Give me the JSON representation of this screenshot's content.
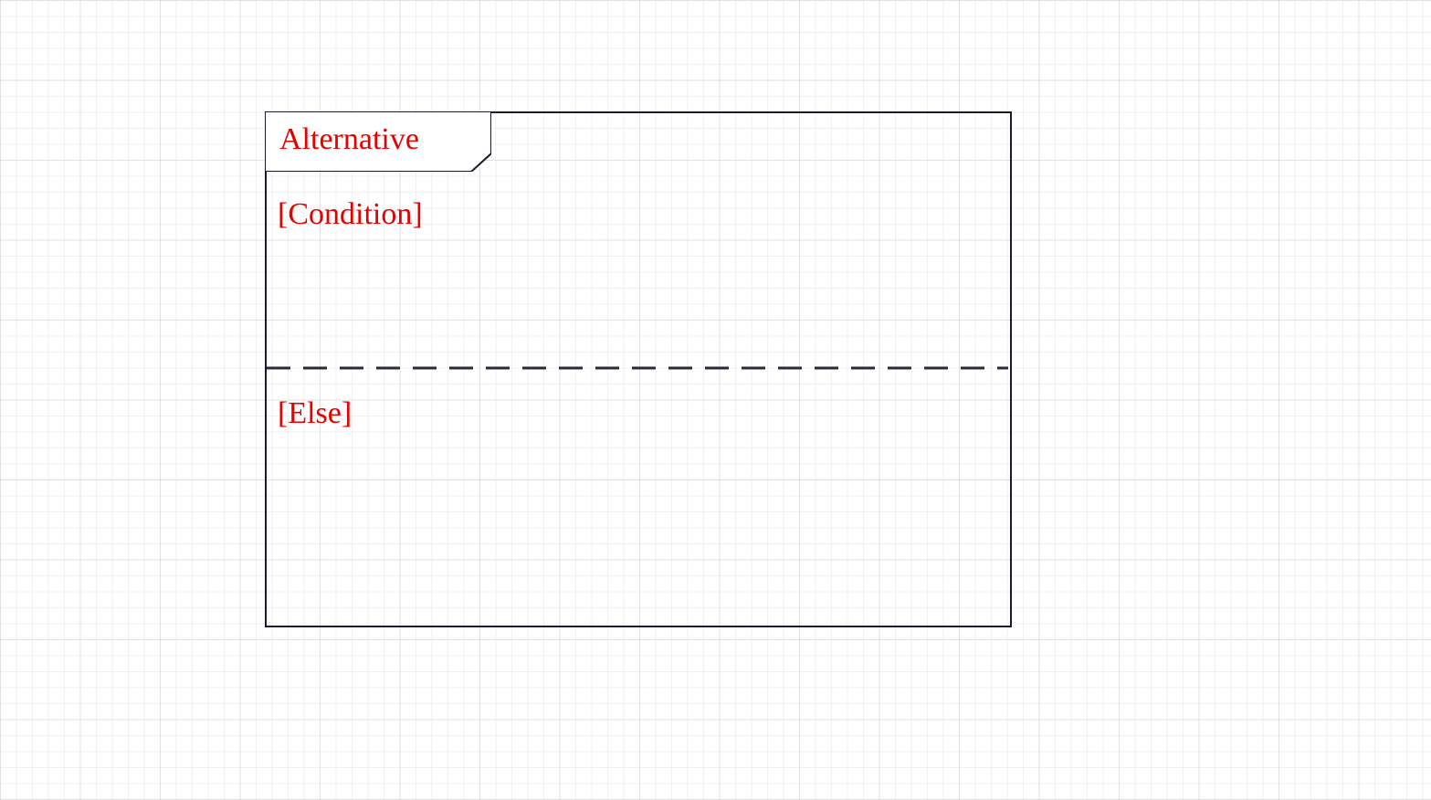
{
  "diagram": {
    "type": "uml-sequence-combined-fragment",
    "operator": "Alternative",
    "operands": [
      {
        "guard": "[Condition]"
      },
      {
        "guard": "[Else]"
      }
    ],
    "colors": {
      "text": "#e60000",
      "border": "#1a1a2e",
      "separator": "#2a2a3e",
      "grid": "#d0d0d0"
    }
  }
}
